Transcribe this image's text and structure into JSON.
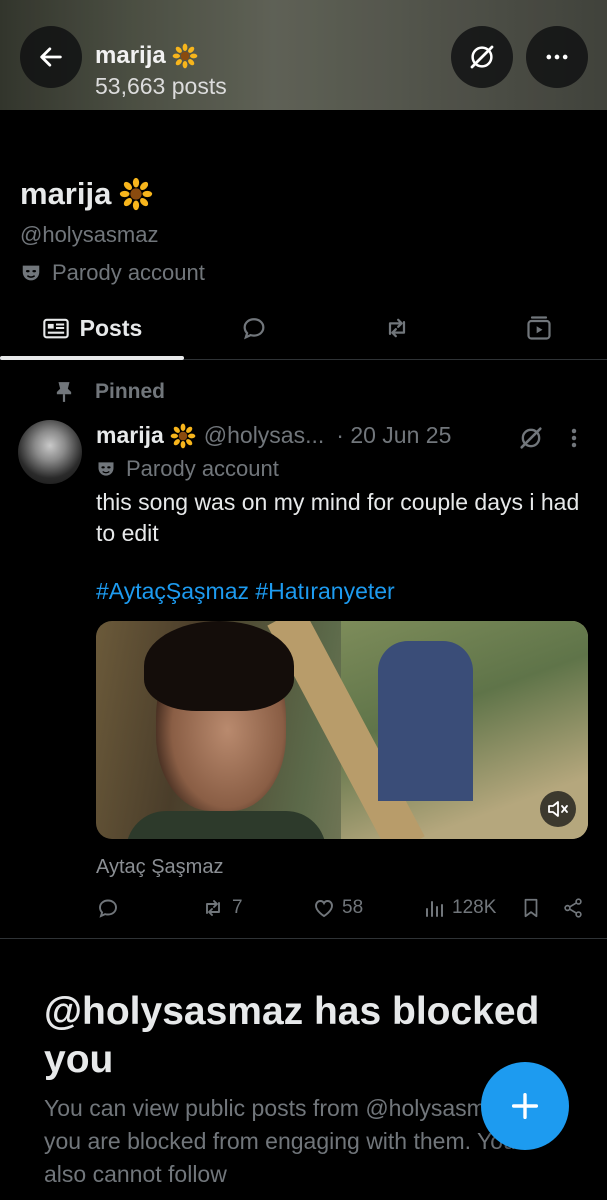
{
  "header": {
    "name": "marija",
    "post_count": "53,663 posts",
    "name_emoji": "sunflower-icon"
  },
  "profile": {
    "name": "marija",
    "handle": "@holysasmaz",
    "badge": "Parody account"
  },
  "tabs": [
    {
      "label": "Posts",
      "icon": "posts-icon",
      "selected": true
    },
    {
      "label": "",
      "icon": "reply-icon",
      "selected": false
    },
    {
      "label": "",
      "icon": "repost-icon",
      "selected": false
    },
    {
      "label": "",
      "icon": "media-icon",
      "selected": false
    }
  ],
  "post": {
    "pinned_label": "Pinned",
    "author": "marija",
    "handle": "@holysas...",
    "date": "· 20 Jun 25",
    "parody_label": "Parody account",
    "text": "this song was on my mind for couple days i had to edit",
    "hashtags": "#AytaçŞaşmaz #Hatıranyeter",
    "media_caption": "Aytaç Şaşmaz",
    "stats": {
      "replies": "",
      "reposts": "7",
      "likes": "58",
      "views": "128K"
    }
  },
  "blocked": {
    "title": "@holysasmaz has blocked you",
    "body": "You can view public posts from @holysasmaz, but you are blocked from engaging with them. You also cannot follow"
  },
  "colors": {
    "accent": "#1d9bf0",
    "background": "#000000",
    "text_primary": "#e7e9ea",
    "text_secondary": "#71767b"
  }
}
